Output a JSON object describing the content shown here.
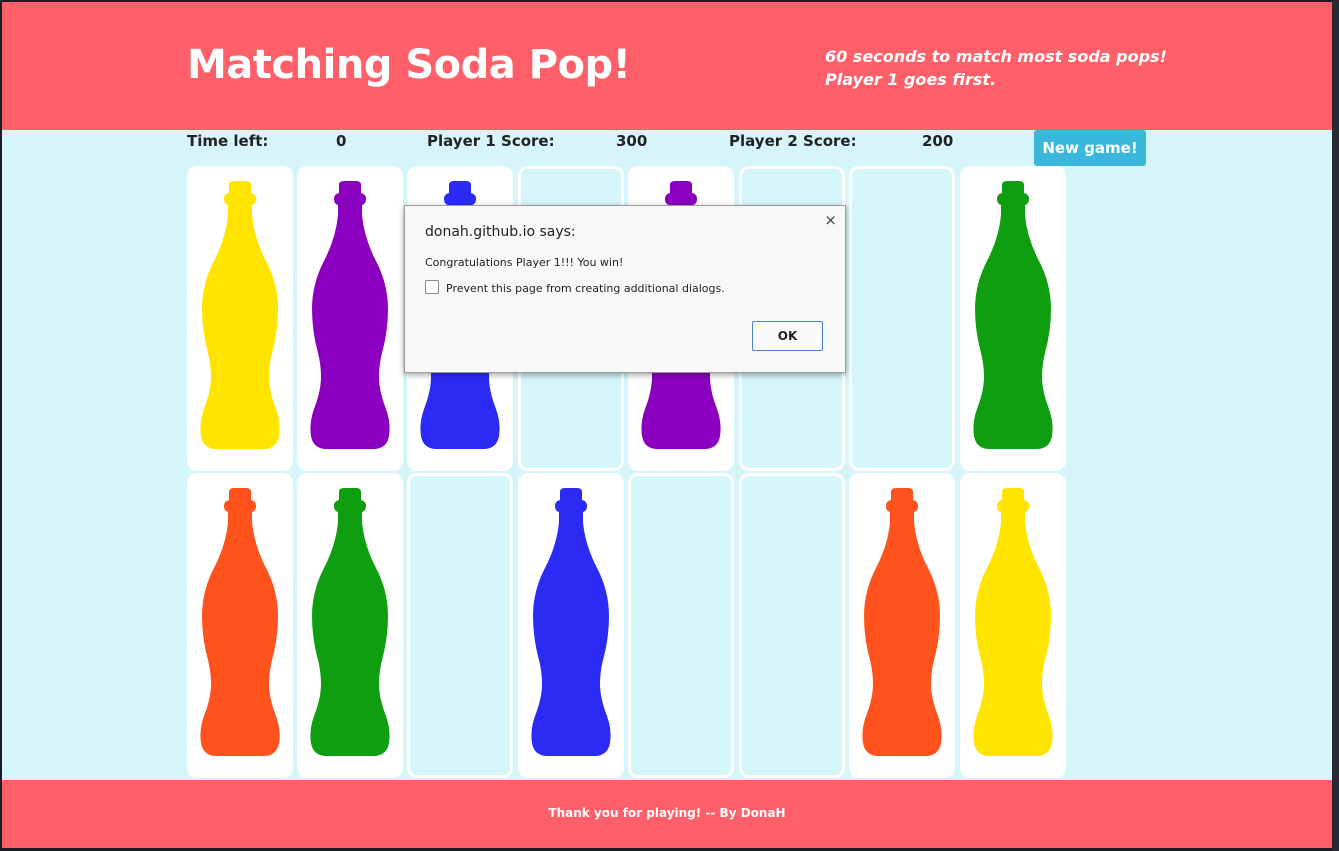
{
  "header": {
    "title": "Matching Soda Pop!",
    "tagline_line1": "60 seconds to match most soda pops!",
    "tagline_line2": "Player 1 goes first."
  },
  "scoreboard": {
    "time_label": "Time left:",
    "time_value": "0",
    "p1_label": "Player 1 Score:",
    "p1_value": "300",
    "p2_label": "Player 2 Score:",
    "p2_value": "200",
    "new_game_label": "New game!"
  },
  "colors": {
    "header_bg": "#ff5f68",
    "page_bg": "#d5f5fa",
    "button_bg": "#3bb7dc",
    "yellow": "#ffe400",
    "purple": "#8b00bf",
    "blue": "#2b2bf5",
    "green": "#0e9e10",
    "orange": "#ff521c"
  },
  "board": {
    "rows": [
      [
        "yellow",
        "purple",
        "blue",
        "empty",
        "purple",
        "empty",
        "empty",
        "green"
      ],
      [
        "orange",
        "green",
        "empty",
        "blue",
        "empty",
        "empty",
        "orange",
        "yellow"
      ]
    ]
  },
  "footer": {
    "text": "Thank you for playing! -- By DonaH"
  },
  "dialog": {
    "title": "donah.github.io says:",
    "message": "Congratulations Player 1!!! You win!",
    "checkbox_label": "Prevent this page from creating additional dialogs.",
    "ok_label": "OK",
    "close_glyph": "×"
  }
}
